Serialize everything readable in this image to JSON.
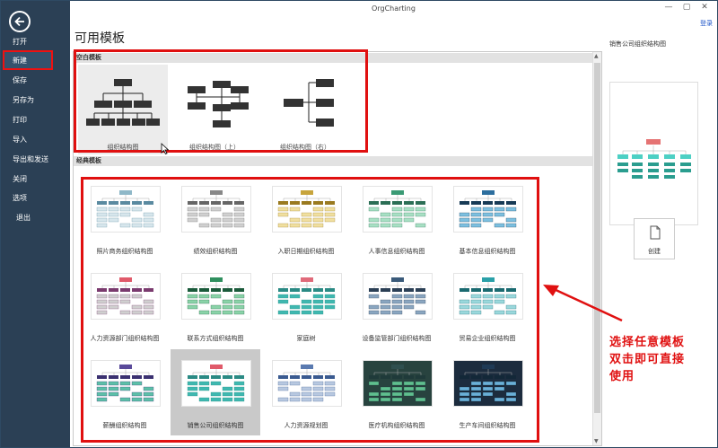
{
  "window": {
    "title": "OrgCharting",
    "login": "登录"
  },
  "sidebar": {
    "items": [
      {
        "label": "打开",
        "id": "open"
      },
      {
        "label": "新建",
        "id": "new"
      },
      {
        "label": "保存",
        "id": "save"
      },
      {
        "label": "另存为",
        "id": "saveas"
      },
      {
        "label": "打印",
        "id": "print"
      },
      {
        "label": "导入",
        "id": "import"
      },
      {
        "label": "导出和发送",
        "id": "export"
      },
      {
        "label": "关闭",
        "id": "close"
      },
      {
        "label": "选项",
        "id": "options"
      },
      {
        "label": "退出",
        "id": "exit"
      }
    ]
  },
  "page_title": "可用模板",
  "blank_section": {
    "title": "空白模板",
    "items": [
      {
        "label": "组织结构图"
      },
      {
        "label": "组织结构图（上）"
      },
      {
        "label": "组织结构图（右）"
      }
    ]
  },
  "classic_section": {
    "title": "经典模板",
    "items": [
      {
        "label": "照片商务组织结构图"
      },
      {
        "label": "绩效组织结构图"
      },
      {
        "label": "入职日期组织结构图"
      },
      {
        "label": "人事信息组织结构图"
      },
      {
        "label": "基本信息组织结构图"
      },
      {
        "label": "人力资源部门组织结构图"
      },
      {
        "label": "联系方式组织结构图"
      },
      {
        "label": "家庭树"
      },
      {
        "label": "设备监管部门组织结构图"
      },
      {
        "label": "贸易企业组织结构图"
      },
      {
        "label": "薪酬组织结构图"
      },
      {
        "label": "销售公司组织结构图"
      },
      {
        "label": "人力资源规划图"
      },
      {
        "label": "医疗机构组织结构图"
      },
      {
        "label": "生产车间组织结构图"
      }
    ]
  },
  "right_panel": {
    "title": "销售公司组织结构图",
    "create_label": "创建"
  },
  "annotation": {
    "lines": [
      "选择任意模板",
      "双击即可直接",
      "使用"
    ]
  },
  "colors": {
    "sidebar": "#2b4055",
    "highlight": "#e01010",
    "link": "#1e55c8"
  }
}
